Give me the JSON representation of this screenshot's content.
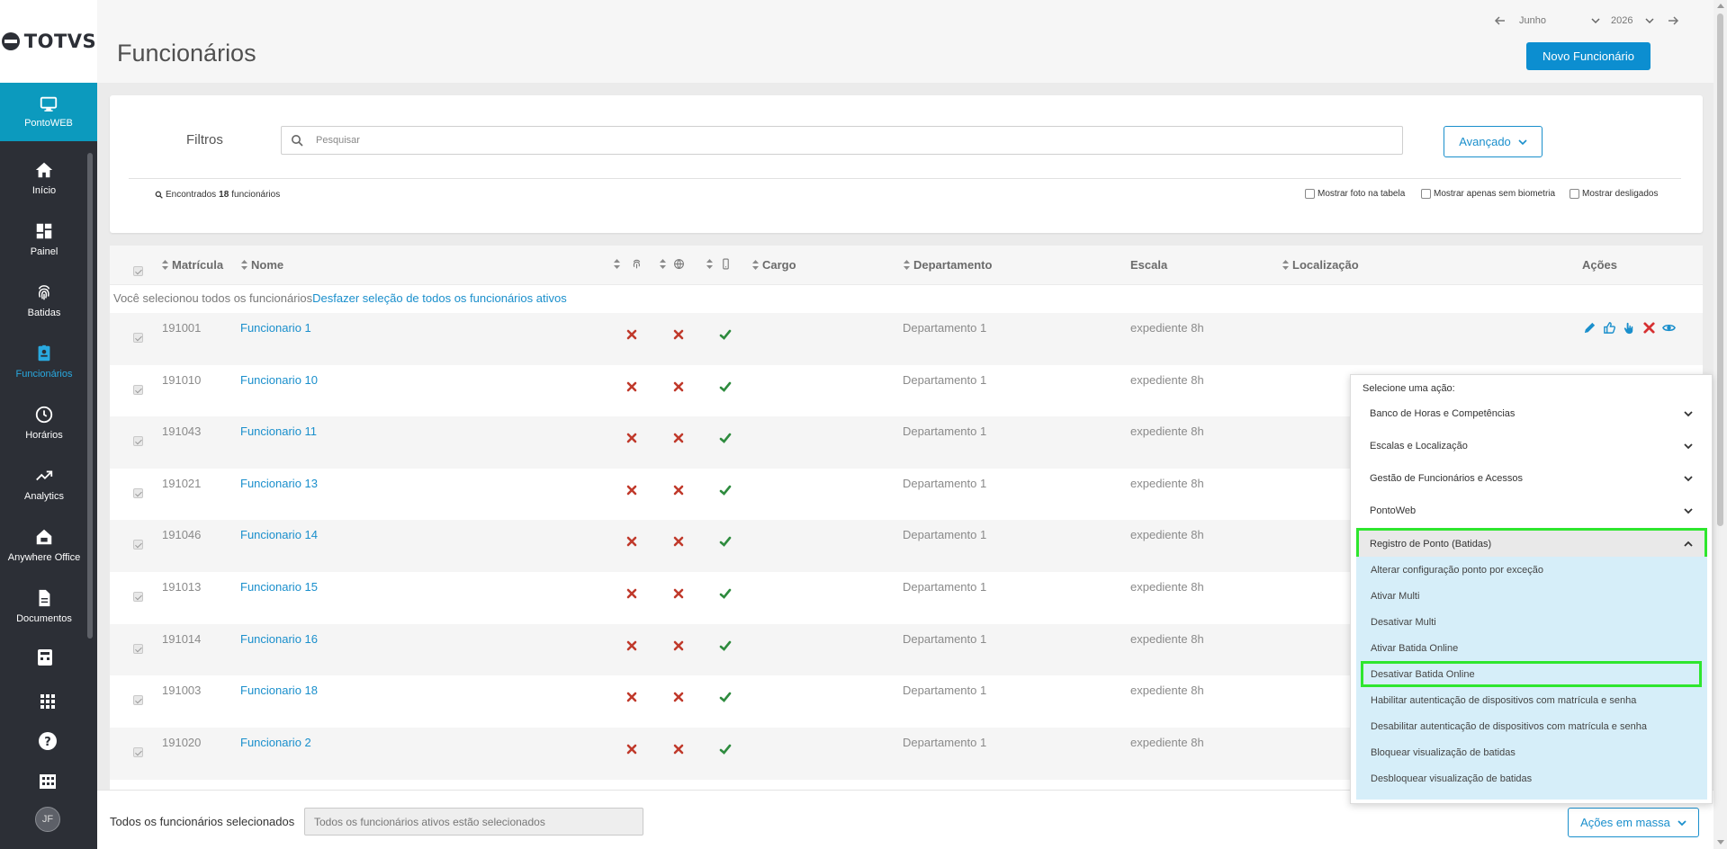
{
  "brand": {
    "name": "TOTVS"
  },
  "sidebar": {
    "module": "PontoWEB",
    "items": [
      {
        "label": "Início",
        "icon": "home-icon"
      },
      {
        "label": "Painel",
        "icon": "dashboard-icon"
      },
      {
        "label": "Batidas",
        "icon": "fingerprint-icon"
      },
      {
        "label": "Funcionários",
        "icon": "employee-badge-icon",
        "active": true
      },
      {
        "label": "Horários",
        "icon": "clock-icon"
      },
      {
        "label": "Analytics",
        "icon": "trending-up-icon"
      },
      {
        "label": "Anywhere Office",
        "icon": "home-office-icon"
      },
      {
        "label": "Documentos",
        "icon": "document-icon"
      }
    ],
    "avatar_initials": "JF"
  },
  "header": {
    "title": "Funcionários",
    "month": "Junho",
    "year": "2026",
    "new_button": "Novo Funcionário"
  },
  "filters": {
    "label": "Filtros",
    "search_placeholder": "Pesquisar",
    "advanced_button": "Avançado",
    "found_prefix": "Encontrados",
    "found_count": "18",
    "found_suffix": "funcionários",
    "options": [
      "Mostrar foto na tabela",
      "Mostrar apenas sem biometria",
      "Mostrar desligados"
    ]
  },
  "table": {
    "columns": {
      "matricula": "Matrícula",
      "nome": "Nome",
      "cargo": "Cargo",
      "departamento": "Departamento",
      "escala": "Escala",
      "localizacao": "Localização",
      "acoes": "Ações"
    },
    "selection_note": "Você selecionou todos os funcionários",
    "undo_selection": "Desfazer seleção de todos os funcionários ativos",
    "rows": [
      {
        "matricula": "191001",
        "nome": "Funcionario 1",
        "departamento": "Departamento 1",
        "escala": "expediente 8h"
      },
      {
        "matricula": "191010",
        "nome": "Funcionario 10",
        "departamento": "Departamento 1",
        "escala": "expediente 8h"
      },
      {
        "matricula": "191043",
        "nome": "Funcionario 11",
        "departamento": "Departamento 1",
        "escala": "expediente 8h"
      },
      {
        "matricula": "191021",
        "nome": "Funcionario 13",
        "departamento": "Departamento 1",
        "escala": "expediente 8h"
      },
      {
        "matricula": "191046",
        "nome": "Funcionario 14",
        "departamento": "Departamento 1",
        "escala": "expediente 8h"
      },
      {
        "matricula": "191013",
        "nome": "Funcionario 15",
        "departamento": "Departamento 1",
        "escala": "expediente 8h"
      },
      {
        "matricula": "191014",
        "nome": "Funcionario 16",
        "departamento": "Departamento 1",
        "escala": "expediente 8h"
      },
      {
        "matricula": "191003",
        "nome": "Funcionario 18",
        "departamento": "Departamento 1",
        "escala": "expediente 8h"
      },
      {
        "matricula": "191020",
        "nome": "Funcionario 2",
        "departamento": "Departamento 1",
        "escala": "expediente 8h"
      }
    ]
  },
  "footer": {
    "label": "Todos os funcionários selecionados",
    "input_value": "Todos os funcionários ativos estão selecionados",
    "mass_button": "Ações em massa"
  },
  "mass_menu": {
    "title": "Selecione uma ação:",
    "groups": [
      "Banco de Horas e Competências",
      "Escalas e Localização",
      "Gestão de Funcionários e Acessos",
      "PontoWeb",
      "Registro de Ponto (Batidas)"
    ],
    "subitems": [
      "Alterar configuração ponto por exceção",
      "Ativar Multi",
      "Desativar Multi",
      "Ativar Batida Online",
      "Desativar Batida Online",
      "Habilitar autenticação de dispositivos com matrícula e senha",
      "Desabilitar autenticação de dispositivos com matrícula e senha",
      "Bloquear visualização de batidas",
      "Desbloquear visualização de batidas"
    ]
  },
  "colors": {
    "accent": "#0c8ed0",
    "sidebar": "#2c2f36",
    "active_nav": "#0c9abe",
    "highlight": "#2ee62e",
    "submenu_bg": "#d6eef9",
    "error_red": "#c0392b",
    "ok_green": "#2e8b3e"
  }
}
